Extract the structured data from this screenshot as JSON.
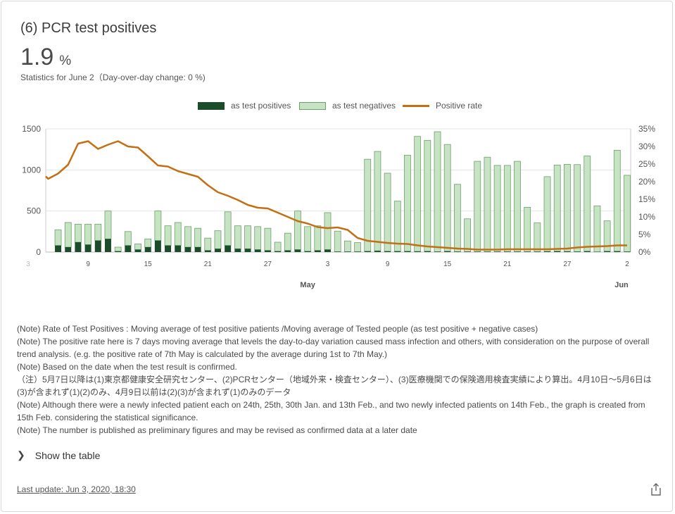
{
  "header": {
    "title": "(6) PCR test positives",
    "value": "1.9",
    "unit": "%",
    "stat_desc": "Statistics for June 2（Day-over-day change: 0 %)"
  },
  "legend": {
    "positives": "as test positives",
    "negatives": "as test negatives",
    "rate": "Positive rate"
  },
  "colors": {
    "positives": "#1b4d2b",
    "negatives": "#c6e3c4",
    "negatives_border": "#6ea06a",
    "rate": "#c36f12"
  },
  "chart_data": {
    "type": "bar",
    "combo": "stacked bar + line (secondary axis)",
    "x_tick_labels": [
      "3",
      "9",
      "15",
      "21",
      "27",
      "3",
      "9",
      "15",
      "21",
      "27",
      "2"
    ],
    "month_labels": [
      "May",
      "Jun"
    ],
    "y_left_ticks": [
      "0",
      "500",
      "1000",
      "1500"
    ],
    "y_right_ticks": [
      "0%",
      "5%",
      "10%",
      "15%",
      "20%",
      "25%",
      "30%",
      "35%"
    ],
    "ylim_left": [
      0,
      1500
    ],
    "ylim_right": [
      0,
      35
    ],
    "grid": true,
    "legend_position": "top-center",
    "dates": [
      "2020-04-03",
      "2020-04-04",
      "2020-04-05",
      "2020-04-06",
      "2020-04-07",
      "2020-04-08",
      "2020-04-09",
      "2020-04-10",
      "2020-04-11",
      "2020-04-12",
      "2020-04-13",
      "2020-04-14",
      "2020-04-15",
      "2020-04-16",
      "2020-04-17",
      "2020-04-18",
      "2020-04-19",
      "2020-04-20",
      "2020-04-21",
      "2020-04-22",
      "2020-04-23",
      "2020-04-24",
      "2020-04-25",
      "2020-04-26",
      "2020-04-27",
      "2020-04-28",
      "2020-04-29",
      "2020-04-30",
      "2020-05-01",
      "2020-05-02",
      "2020-05-03",
      "2020-05-04",
      "2020-05-05",
      "2020-05-06",
      "2020-05-07",
      "2020-05-08",
      "2020-05-09",
      "2020-05-10",
      "2020-05-11",
      "2020-05-12",
      "2020-05-13",
      "2020-05-14",
      "2020-05-15",
      "2020-05-16",
      "2020-05-17",
      "2020-05-18",
      "2020-05-19",
      "2020-05-20",
      "2020-05-21",
      "2020-05-22",
      "2020-05-23",
      "2020-05-24",
      "2020-05-25",
      "2020-05-26",
      "2020-05-27",
      "2020-05-28",
      "2020-05-29",
      "2020-05-30",
      "2020-05-31",
      "2020-06-01",
      "2020-06-02"
    ],
    "series": [
      {
        "name": "as test positives",
        "values": [
          0,
          0,
          60,
          80,
          60,
          120,
          90,
          140,
          160,
          10,
          80,
          30,
          60,
          140,
          80,
          80,
          60,
          60,
          20,
          40,
          80,
          40,
          40,
          30,
          20,
          10,
          20,
          30,
          10,
          20,
          30,
          5,
          5,
          5,
          10,
          15,
          10,
          10,
          10,
          8,
          10,
          5,
          10,
          5,
          5,
          5,
          5,
          5,
          5,
          5,
          5,
          5,
          8,
          10,
          8,
          5,
          10,
          3,
          10,
          10,
          5
        ]
      },
      {
        "name": "as test negatives",
        "values": [
          0,
          0,
          290,
          190,
          300,
          220,
          250,
          200,
          340,
          50,
          170,
          70,
          100,
          360,
          240,
          280,
          250,
          230,
          150,
          220,
          410,
          280,
          280,
          280,
          270,
          110,
          210,
          470,
          300,
          300,
          450,
          250,
          130,
          110,
          1120,
          1210,
          950,
          610,
          1170,
          1400,
          1350,
          1460,
          1300,
          820,
          400,
          1100,
          1150,
          1050,
          1050,
          1100,
          540,
          350,
          910,
          1050,
          1060,
          1060,
          1160,
          560,
          370,
          1230,
          930
        ]
      },
      {
        "name": "Positive rate",
        "values": [
          20.5,
          21.5,
          20.8,
          22.3,
          24.8,
          30.8,
          31.5,
          29.3,
          30.5,
          31.5,
          30.0,
          29.7,
          27.2,
          24.6,
          24.3,
          23.0,
          22.2,
          21.4,
          19.0,
          17.0,
          16.0,
          14.8,
          13.4,
          12.6,
          12.4,
          11.2,
          10.0,
          8.8,
          8.1,
          7.1,
          6.8,
          7.0,
          6.3,
          4.0,
          3.2,
          2.9,
          2.6,
          2.4,
          2.3,
          1.9,
          1.6,
          1.4,
          1.2,
          1.0,
          0.9,
          0.7,
          0.7,
          0.7,
          0.8,
          0.8,
          0.8,
          0.8,
          0.8,
          0.9,
          1.0,
          1.3,
          1.5,
          1.6,
          1.7,
          1.9,
          1.9
        ]
      }
    ]
  },
  "notes": [
    "(Note) Rate of Test Positives : Moving average of test positive patients /Moving average of Tested people (as test positive + negative cases)",
    "(Note) The positive rate here is 7 days moving average that levels the day-to-day variation caused mass infection and others, with consideration on the purpose of overall trend analysis. (e.g. the positive rate of 7th May is calculated by the average during 1st to 7th May.)",
    "(Note) Based on the date when the test result is confirmed.",
    "（注）5月7日以降は(1)東京都健康安全研究センター、(2)PCRセンター（地域外来・検査センター）、(3)医療機関での保険適用検査実績により算出。4月10日～5月6日は(3)が含まれず(1)(2)のみ、4月9日以前は(2)(3)が含まれず(1)のみのデータ",
    "(Note) Although there were a newly infected patient each on 24th, 25th, 30th Jan. and 13th Feb., and two newly infected patients on 14th Feb., the graph is created from 15th Feb. considering the statistical significance.",
    "(Note) The number is published as preliminary figures and may be revised as confirmed data at a later date"
  ],
  "show_table": "Show the table",
  "last_update": "Last update: Jun 3, 2020, 18:30",
  "icons": {
    "expand": "chevron-right-icon",
    "share": "share-icon"
  }
}
